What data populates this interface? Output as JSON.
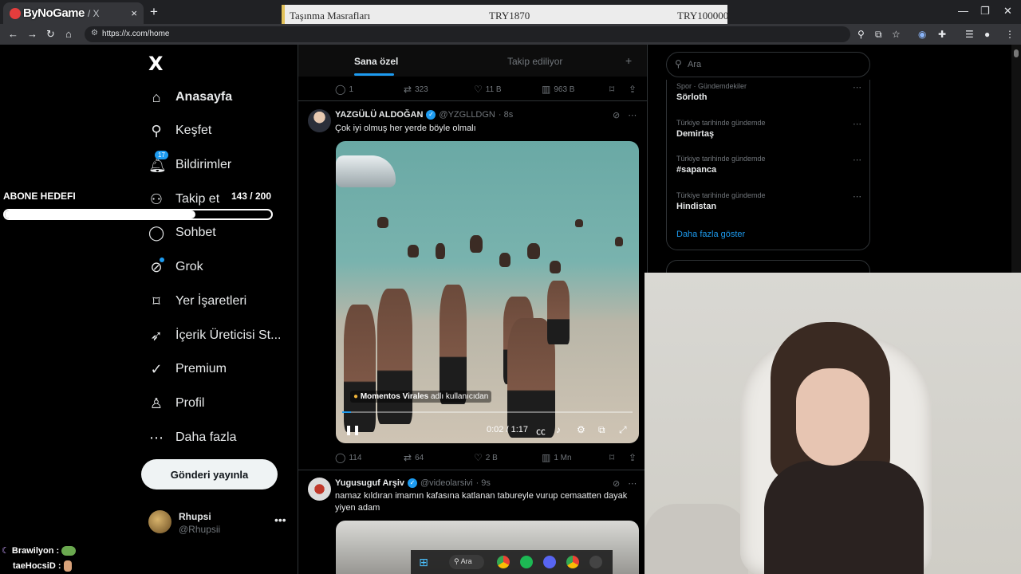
{
  "browser": {
    "brand": "ByNoGame",
    "tab_title": "/ X",
    "tab_close": "×",
    "new_tab": "+",
    "url": "https://x.com/home"
  },
  "stream_overlay": {
    "label": "Taşınma Masrafları",
    "current": "TRY1870",
    "goal": "TRY100000"
  },
  "sub_goal": {
    "title": "ABONE HEDEFI",
    "count_text": "143 / 200",
    "current": 143,
    "target": 200
  },
  "chat": [
    {
      "user": "Brawilyon :"
    },
    {
      "user": "taeHocsiD :"
    }
  ],
  "sidebar": {
    "logo": "X",
    "items": [
      {
        "label": "Anasayfa",
        "icon": "home-icon",
        "active": true
      },
      {
        "label": "Keşfet",
        "icon": "search-icon"
      },
      {
        "label": "Bildirimler",
        "icon": "bell-icon",
        "badge": "17"
      },
      {
        "label": "Takip et",
        "icon": "follow-icon"
      },
      {
        "label": "Sohbet",
        "icon": "chat-icon"
      },
      {
        "label": "Grok",
        "icon": "grok-icon"
      },
      {
        "label": "Yer İşaretleri",
        "icon": "bookmark-icon"
      },
      {
        "label": "İçerik Üreticisi St...",
        "icon": "rocket-icon"
      },
      {
        "label": "Premium",
        "icon": "premium-icon"
      },
      {
        "label": "Profil",
        "icon": "profile-icon"
      },
      {
        "label": "Daha fazla",
        "icon": "more-icon"
      }
    ],
    "post_button": "Gönderi yayınla",
    "profile": {
      "name": "Rhupsi",
      "handle": "@Rhupsii",
      "more": "•••"
    }
  },
  "feed": {
    "tabs": [
      "Sana özel",
      "Takip ediliyor"
    ],
    "add_tab": "+",
    "top_actions": {
      "replies": "1",
      "reposts": "323",
      "likes": "11 B",
      "views": "963 B"
    },
    "tweets": [
      {
        "name": "YAZGÜLÜ ALDOĞAN",
        "handle": "@YZGLLDGN",
        "time": "· 8s",
        "text": "Çok iyi olmuş her yerde böyle olmalı",
        "media_credit_user": "Momentos Virales",
        "media_credit_suffix": "adlı kullanıcıdan",
        "video_time": "0:02 / 1:17",
        "progress": 0.03,
        "actions": {
          "replies": "114",
          "reposts": "64",
          "likes": "2 B",
          "views": "1 Mn"
        }
      },
      {
        "name": "Yugusuguf Arşiv",
        "handle": "@videolarsivi",
        "time": "· 9s",
        "text": "namaz kıldıran imamın kafasına katlanan tabureyle vurup cemaatten dayak yiyen adam"
      }
    ]
  },
  "right": {
    "search_placeholder": "Ara",
    "trends": [
      {
        "meta": "Spor · Gündemdekiler",
        "topic": "Sörloth"
      },
      {
        "meta": "Türkiye tarihinde gündemde",
        "topic": "Demirtaş"
      },
      {
        "meta": "Türkiye tarihinde gündemde",
        "topic": "#sapanca"
      },
      {
        "meta": "Türkiye tarihinde gündemde",
        "topic": "Hindistan"
      }
    ],
    "show_more": "Daha fazla göster"
  },
  "taskbar": {
    "search": "Ara"
  }
}
